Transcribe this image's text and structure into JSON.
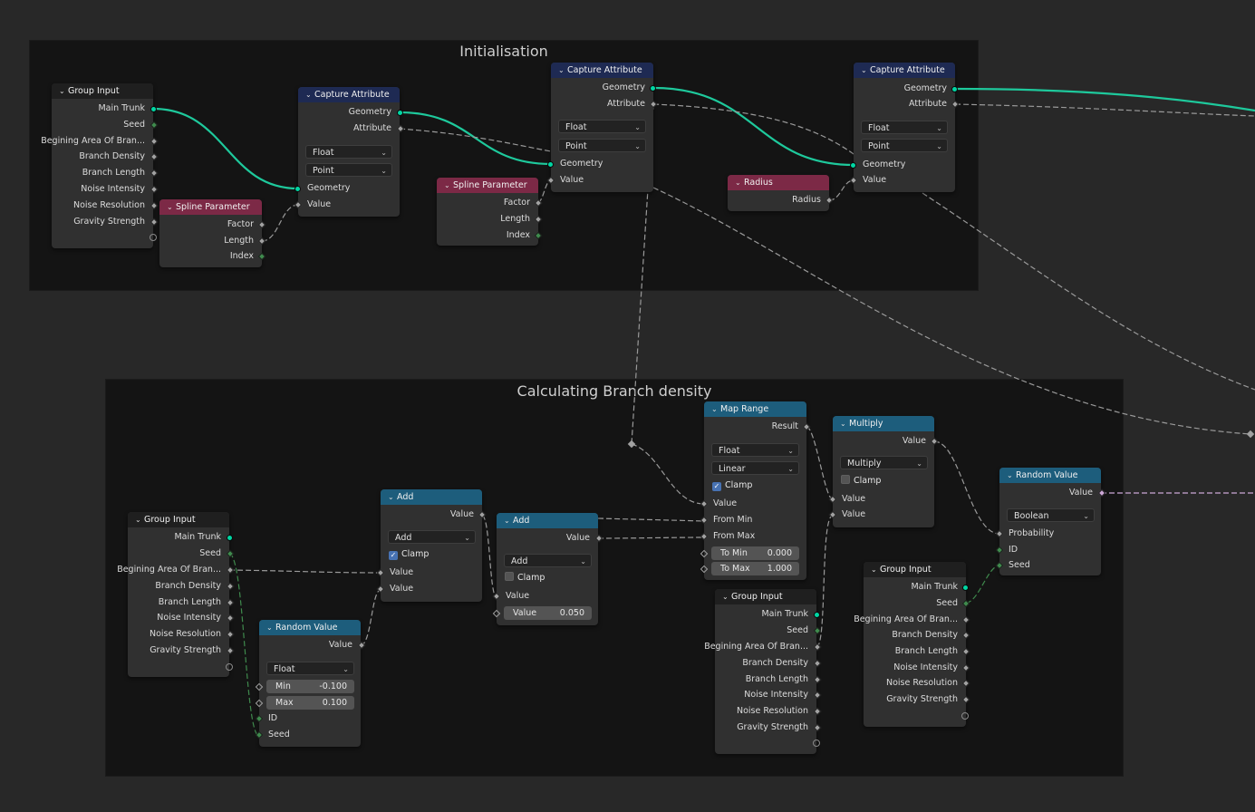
{
  "frames": {
    "init": "Initialisation",
    "branch": "Calculating Branch density"
  },
  "group_input_sockets": [
    "Main Trunk",
    "Seed",
    "Begining Area Of Bran...",
    "Branch Density",
    "Branch Length",
    "Noise Intensity",
    "Noise Resolution",
    "Gravity Strength"
  ],
  "gi1": {
    "title": "Group Input"
  },
  "sp1": {
    "title": "Spline Parameter",
    "factor": "Factor",
    "length": "Length",
    "index": "Index"
  },
  "ca1": {
    "title": "Capture Attribute",
    "geometry": "Geometry",
    "attribute": "Attribute",
    "type": "Float",
    "domain": "Point",
    "geo_in": "Geometry",
    "value_in": "Value"
  },
  "sp2": {
    "title": "Spline Parameter",
    "factor": "Factor",
    "length": "Length",
    "index": "Index"
  },
  "ca2": {
    "title": "Capture Attribute",
    "geometry": "Geometry",
    "attribute": "Attribute",
    "type": "Float",
    "domain": "Point",
    "geo_in": "Geometry",
    "value_in": "Value"
  },
  "rad": {
    "title": "Radius",
    "radius": "Radius"
  },
  "ca3": {
    "title": "Capture Attribute",
    "geometry": "Geometry",
    "attribute": "Attribute",
    "type": "Float",
    "domain": "Point",
    "geo_in": "Geometry",
    "value_in": "Value"
  },
  "gi2": {
    "title": "Group Input"
  },
  "rv1": {
    "title": "Random Value",
    "value": "Value",
    "type": "Float",
    "min_label": "Min",
    "min": "-0.100",
    "max_label": "Max",
    "max": "0.100",
    "id": "ID",
    "seed": "Seed"
  },
  "add1": {
    "title": "Add",
    "value_out": "Value",
    "op": "Add",
    "clamp": "Clamp",
    "clamp_on": true,
    "v1": "Value",
    "v2": "Value"
  },
  "add2": {
    "title": "Add",
    "value_out": "Value",
    "op": "Add",
    "clamp": "Clamp",
    "clamp_on": false,
    "v1": "Value",
    "field_label": "Value",
    "field": "0.050"
  },
  "mr": {
    "title": "Map Range",
    "result": "Result",
    "type": "Float",
    "interp": "Linear",
    "clamp": "Clamp",
    "clamp_on": true,
    "value": "Value",
    "from_min": "From Min",
    "from_max": "From Max",
    "to_min_label": "To Min",
    "to_min": "0.000",
    "to_max_label": "To Max",
    "to_max": "1.000"
  },
  "mul": {
    "title": "Multiply",
    "value_out": "Value",
    "op": "Multiply",
    "clamp": "Clamp",
    "clamp_on": false,
    "v1": "Value",
    "v2": "Value"
  },
  "gi3": {
    "title": "Group Input"
  },
  "gi4": {
    "title": "Group Input"
  },
  "rv2": {
    "title": "Random Value",
    "value": "Value",
    "type": "Boolean",
    "probability": "Probability",
    "id": "ID",
    "seed": "Seed"
  },
  "colors": {
    "background": "#282828",
    "frame": "#141414",
    "node": "#303030",
    "geometry_socket": "#00d6a3",
    "float_socket": "#a1a1a1",
    "int_socket": "#3f8a4d",
    "bool_socket": "#cca6d6",
    "header_input": "#1f1f1f",
    "header_geometry": "#1e2a53",
    "header_attribute": "#7c2946",
    "header_math": "#1d5d7c"
  }
}
